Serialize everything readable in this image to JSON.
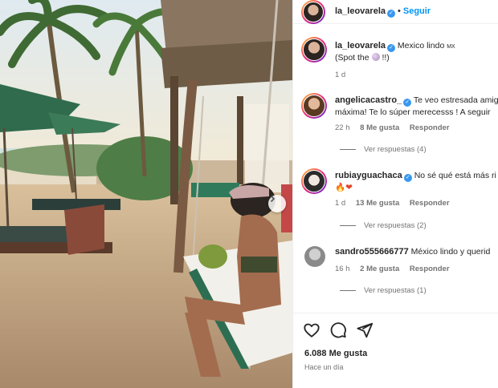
{
  "post": {
    "username": "la_leovarela",
    "follow_label": "Seguir",
    "dot": "•",
    "caption_text": "Mexico lindo",
    "caption_flag": "MX",
    "caption_line2_pre": "(Spot the",
    "caption_line2_post": "!!)",
    "caption_age": "1 d"
  },
  "comments": [
    {
      "username": "angelicacastro_",
      "verified": true,
      "text_line1": "Te veo estresada amig",
      "text_line2": "máxima! Te lo súper merecesss ! A seguir",
      "age": "22 h",
      "likes": "8 Me gusta",
      "reply_label": "Responder",
      "replies_label": "Ver respuestas (4)"
    },
    {
      "username": "rubiayguachaca",
      "verified": true,
      "text_line1": "No sé qué está más ri",
      "emoji": "🔥❤",
      "age": "1 d",
      "likes": "13 Me gusta",
      "reply_label": "Responder",
      "replies_label": "Ver respuestas (2)"
    },
    {
      "username": "sandro555666777",
      "verified": false,
      "text_line1": "México lindo y querid",
      "age": "16 h",
      "likes": "2 Me gusta",
      "reply_label": "Responder",
      "replies_label": "Ver respuestas (1)"
    }
  ],
  "footer": {
    "likes": "6.088 Me gusta",
    "time": "Hace un día"
  },
  "icons": {
    "like": "heart-icon",
    "comment": "comment-icon",
    "share": "share-icon",
    "next": "chevron-right-icon"
  },
  "colors": {
    "link": "#0095f6",
    "verified": "#3897f0",
    "muted": "#737373"
  }
}
